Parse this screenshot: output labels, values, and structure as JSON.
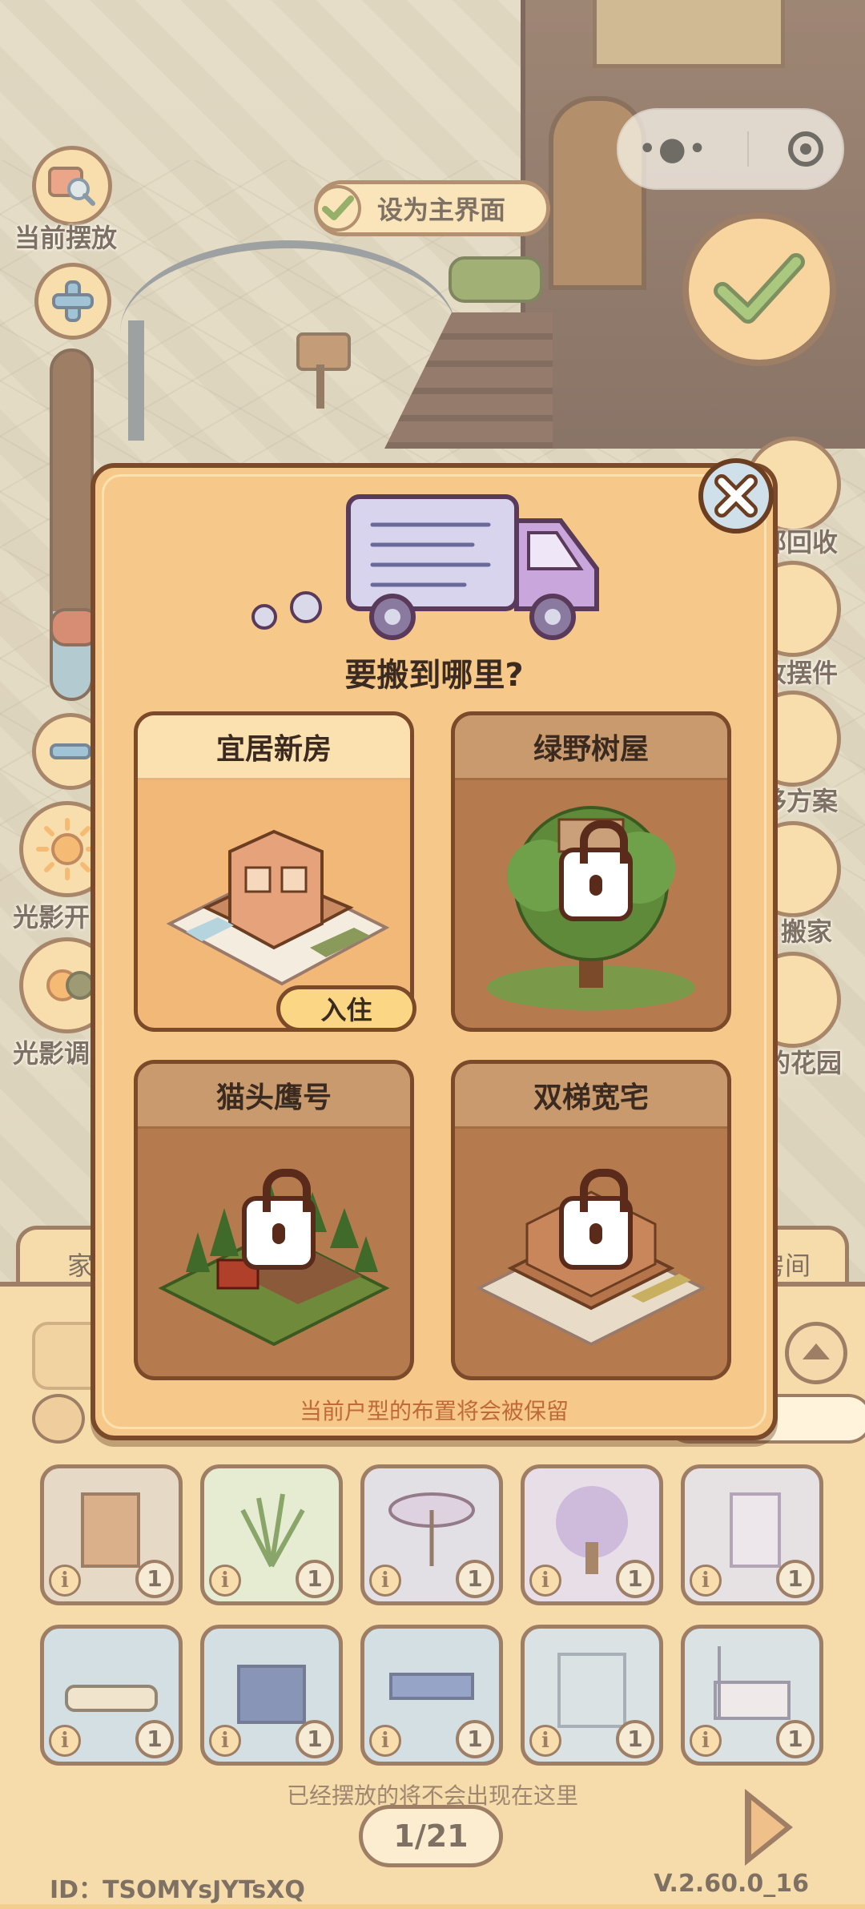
{
  "top_left": {
    "current_placement_label": "当前摆放",
    "light_toggle_label": "光影开",
    "light_adjust_label": "光影调"
  },
  "set_home": {
    "label": "设为主界面"
  },
  "right_side": {
    "recycle_label": "部回收",
    "retrieve_label": "收摆件",
    "plan_label": "移方案",
    "move_label": "搬家",
    "garden_label": "的花园"
  },
  "modal": {
    "title": "要搬到哪里?",
    "note": "当前户型的布置将会被保留",
    "houses": [
      {
        "name": "宜居新房",
        "locked": false,
        "action": "入住"
      },
      {
        "name": "绿野树屋",
        "locked": true
      },
      {
        "name": "猫头鹰号",
        "locked": true
      },
      {
        "name": "双梯宽宅",
        "locked": true
      }
    ]
  },
  "bottom_panel": {
    "tab_left": "家",
    "tab_right": "房间",
    "items": [
      {
        "name": "canopy-bench",
        "info": "i",
        "qty": "1"
      },
      {
        "name": "grass-plant",
        "info": "i",
        "qty": "1"
      },
      {
        "name": "parasol-lamp",
        "info": "i",
        "qty": "1"
      },
      {
        "name": "wisteria-tree",
        "info": "i",
        "qty": "1"
      },
      {
        "name": "curtain-panel",
        "info": "i",
        "qty": "1"
      },
      {
        "name": "chaise-longue",
        "info": "i",
        "qty": "1"
      },
      {
        "name": "blue-nightstand",
        "info": "i",
        "qty": "1"
      },
      {
        "name": "blue-table",
        "info": "i",
        "qty": "1"
      },
      {
        "name": "sheer-canopy",
        "info": "i",
        "qty": "1"
      },
      {
        "name": "canopy-bed",
        "info": "i",
        "qty": "1"
      }
    ],
    "hint": "已经摆放的将不会出现在这里",
    "pager": "1/21"
  },
  "footer": {
    "id": "ID：TSOMYsJYTsXQ",
    "version": "V.2.60.0_16"
  },
  "colors": {
    "panel": "#f6c98a",
    "border": "#7a4a2a",
    "locked_card": "#b57b4e",
    "note_text": "#c06a3a"
  }
}
